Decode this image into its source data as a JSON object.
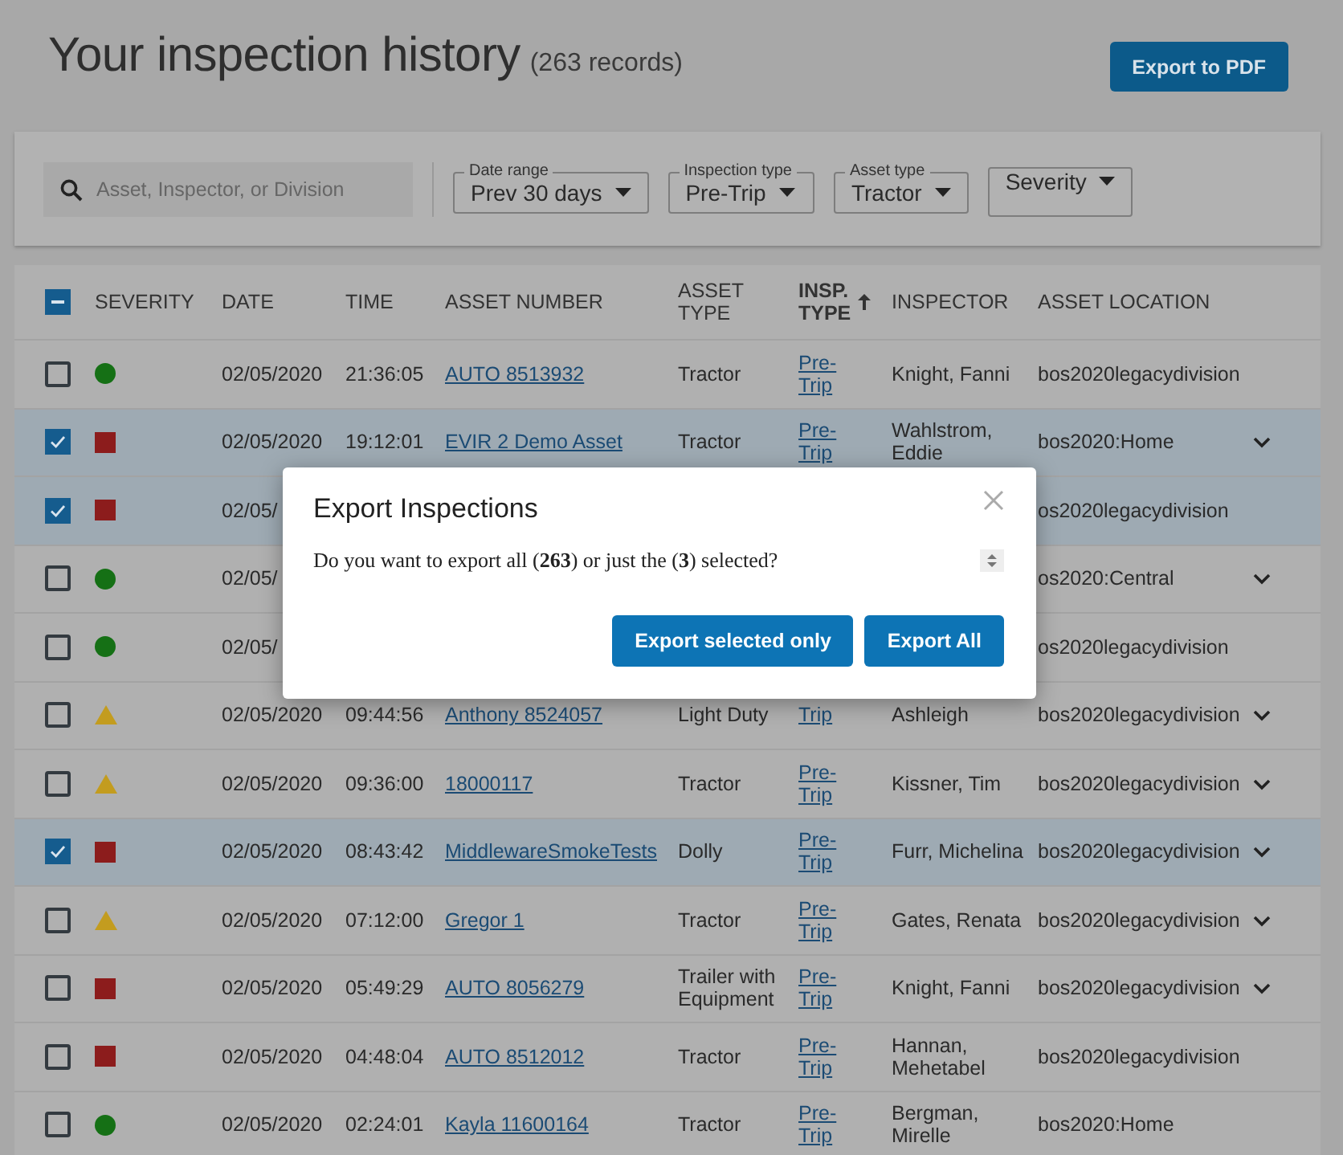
{
  "header": {
    "title": "Your inspection history",
    "record_count": "(263 records)",
    "export_button": "Export to PDF"
  },
  "filters": {
    "search": {
      "placeholder": "Asset, Inspector, or Division"
    },
    "dropdowns": [
      {
        "label": "Date range",
        "value": "Prev 30 days"
      },
      {
        "label": "Inspection type",
        "value": "Pre-Trip"
      },
      {
        "label": "Asset type",
        "value": "Tractor"
      },
      {
        "value": "Severity"
      }
    ]
  },
  "table": {
    "select_all": {
      "indeterminate": true
    },
    "columns": [
      {
        "label": "SEVERITY",
        "sorted": false
      },
      {
        "label": "DATE",
        "sorted": false
      },
      {
        "label": "TIME",
        "sorted": false
      },
      {
        "label": "ASSET NUMBER",
        "sorted": false
      },
      {
        "label": "ASSET TYPE",
        "sorted": false
      },
      {
        "label": "INSP. TYPE",
        "sorted": true
      },
      {
        "label": "INSPECTOR",
        "sorted": false
      },
      {
        "label": "ASSET LOCATION",
        "sorted": false
      }
    ],
    "rows": [
      {
        "selected": false,
        "status_icon": {
          "kind": "circle",
          "color": "#157015"
        },
        "date": "02/05/2020",
        "time": "21:36:05",
        "asset_number": "AUTO 8513932",
        "asset_type": "Tractor",
        "insp_type": "Pre-Trip",
        "inspector": "Knight, Fanni",
        "location": "bos2020legacydivision",
        "expandable": false
      },
      {
        "selected": true,
        "status_icon": {
          "kind": "square",
          "color": "#8c1c1c"
        },
        "date": "02/05/2020",
        "time": "19:12:01",
        "asset_number": "EVIR 2 Demo Asset",
        "asset_type": "Tractor",
        "insp_type": "Pre-Trip",
        "inspector": "Wahlstrom, Eddie",
        "location": "bos2020:Home",
        "expandable": true
      },
      {
        "selected": true,
        "status_icon": {
          "kind": "square",
          "color": "#8c1c1c"
        },
        "date": "02/05/",
        "location": "os2020legacydivision",
        "expandable": false
      },
      {
        "selected": false,
        "status_icon": {
          "kind": "circle",
          "color": "#157015"
        },
        "date": "02/05/",
        "location": "os2020:Central",
        "expandable": true
      },
      {
        "selected": false,
        "status_icon": {
          "kind": "circle",
          "color": "#157015"
        },
        "date": "02/05/",
        "location": "os2020legacydivision",
        "expandable": false
      },
      {
        "selected": false,
        "status_icon": {
          "kind": "triangle",
          "color": "#c39c1f"
        },
        "date": "02/05/2020",
        "time": "09:44:56",
        "asset_number": "Anthony 8524057",
        "asset_type": "Light Duty",
        "insp_type": "Trip",
        "inspector": "Ashleigh",
        "location": "bos2020legacydivision",
        "expandable": true
      },
      {
        "selected": false,
        "status_icon": {
          "kind": "triangle",
          "color": "#c39c1f"
        },
        "date": "02/05/2020",
        "time": "09:36:00",
        "asset_number": "18000117",
        "asset_type": "Tractor",
        "insp_type": "Pre-Trip",
        "inspector": "Kissner, Tim",
        "location": "bos2020legacydivision",
        "expandable": true
      },
      {
        "selected": true,
        "status_icon": {
          "kind": "square",
          "color": "#8c1c1c"
        },
        "date": "02/05/2020",
        "time": "08:43:42",
        "asset_number": "MiddlewareSmokeTests",
        "asset_type": "Dolly",
        "insp_type": "Pre-Trip",
        "inspector": "Furr, Michelina",
        "location": "bos2020legacydivision",
        "expandable": true
      },
      {
        "selected": false,
        "status_icon": {
          "kind": "triangle",
          "color": "#c39c1f"
        },
        "date": "02/05/2020",
        "time": "07:12:00",
        "asset_number": "Gregor 1",
        "asset_type": "Tractor",
        "insp_type": "Pre-Trip",
        "inspector": "Gates, Renata",
        "location": "bos2020legacydivision",
        "expandable": true
      },
      {
        "selected": false,
        "status_icon": {
          "kind": "square",
          "color": "#8c1c1c"
        },
        "date": "02/05/2020",
        "time": "05:49:29",
        "asset_number": "AUTO 8056279",
        "asset_type": "Trailer with Equipment",
        "insp_type": "Pre-Trip",
        "inspector": "Knight, Fanni",
        "location": "bos2020legacydivision",
        "expandable": true
      },
      {
        "selected": false,
        "status_icon": {
          "kind": "square",
          "color": "#8c1c1c"
        },
        "date": "02/05/2020",
        "time": "04:48:04",
        "asset_number": "AUTO 8512012",
        "asset_type": "Tractor",
        "insp_type": "Pre-Trip",
        "inspector": "Hannan, Mehetabel",
        "location": "bos2020legacydivision",
        "expandable": false
      },
      {
        "selected": false,
        "status_icon": {
          "kind": "circle",
          "color": "#157015"
        },
        "date": "02/05/2020",
        "time": "02:24:01",
        "asset_number": "Kayla 11600164",
        "asset_type": "Tractor",
        "insp_type": "Pre-Trip",
        "inspector": "Bergman, Mirelle",
        "location": "bos2020:Home",
        "expandable": false
      }
    ]
  },
  "dialog": {
    "title": "Export Inspections",
    "message": "Do you want to export all (**263**) or just the (**3**) selected?",
    "buttons": [
      "Export selected only",
      "Export All"
    ]
  }
}
